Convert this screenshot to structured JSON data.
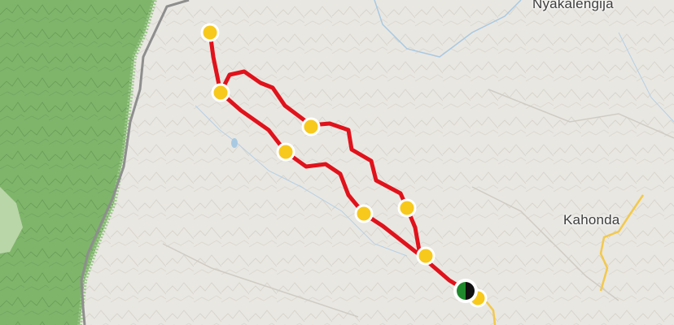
{
  "map": {
    "places": [
      {
        "id": "nyakalengija",
        "name": "Nyakalengija"
      },
      {
        "id": "kahonda",
        "name": "Kahonda"
      }
    ],
    "trail": {
      "name": "",
      "color": "#e0121b"
    },
    "waypoint_color": "#f7c91c",
    "trailhead_icon": "start-end-marker-icon",
    "colors": {
      "terrain": "#e9e7e2",
      "park": "#7fb56b",
      "park_edge": "#9cc98a",
      "road": "#8e8e8e",
      "minor_road": "#f2c94c",
      "water": "#a9c9e2",
      "ridge": "#cfccc4"
    }
  }
}
